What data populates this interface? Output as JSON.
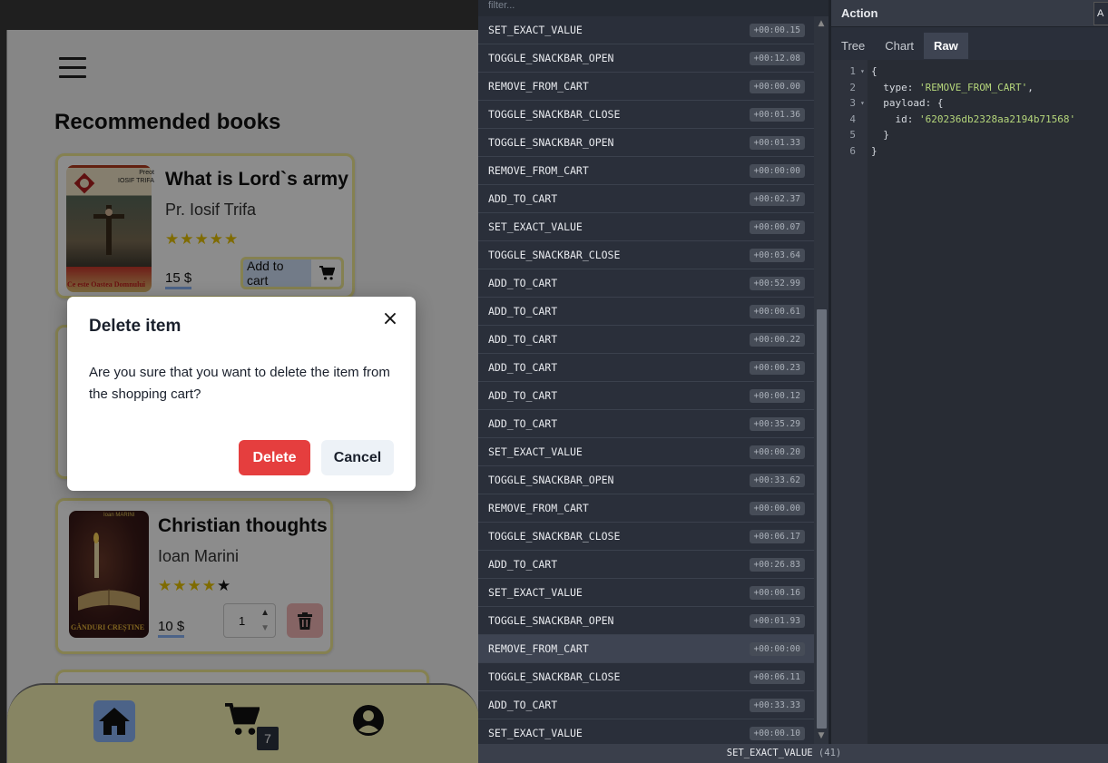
{
  "app": {
    "section_title": "Recommended books",
    "books": [
      {
        "title": "What is Lord`s army",
        "author": "Pr. Iosif Trifa",
        "rating": 5,
        "stars_full": "★★★★★",
        "stars_empty": "",
        "price": "15 $",
        "action_label": "Add to cart",
        "cover_top_text": "Preot\nIOSIF TRIFA",
        "cover_bottom_text": "Ce este Oastea Domnului"
      },
      {
        "title": "Christian thoughts",
        "author": "Ioan Marini",
        "rating": 4,
        "stars_full": "★★★★",
        "stars_empty": "★",
        "price": "10 $",
        "quantity": "1",
        "cover_top_text": "Ioan MARINI",
        "cover_bottom_text": "GÂNDURI CREȘTINE"
      }
    ],
    "cart_count": "7"
  },
  "dialog": {
    "title": "Delete item",
    "body": "Are you sure that you want to delete the item from the shopping cart?",
    "delete_label": "Delete",
    "cancel_label": "Cancel",
    "close_glyph": "×"
  },
  "devtools": {
    "filter_placeholder": "filter...",
    "actions": [
      {
        "name": "SET_EXACT_VALUE",
        "time": "+00:00.15"
      },
      {
        "name": "TOGGLE_SNACKBAR_OPEN",
        "time": "+00:12.08"
      },
      {
        "name": "REMOVE_FROM_CART",
        "time": "+00:00.00"
      },
      {
        "name": "TOGGLE_SNACKBAR_CLOSE",
        "time": "+00:01.36"
      },
      {
        "name": "TOGGLE_SNACKBAR_OPEN",
        "time": "+00:01.33"
      },
      {
        "name": "REMOVE_FROM_CART",
        "time": "+00:00:00"
      },
      {
        "name": "ADD_TO_CART",
        "time": "+00:02.37"
      },
      {
        "name": "SET_EXACT_VALUE",
        "time": "+00:00.07"
      },
      {
        "name": "TOGGLE_SNACKBAR_CLOSE",
        "time": "+00:03.64"
      },
      {
        "name": "ADD_TO_CART",
        "time": "+00:52.99"
      },
      {
        "name": "ADD_TO_CART",
        "time": "+00:00.61"
      },
      {
        "name": "ADD_TO_CART",
        "time": "+00:00.22"
      },
      {
        "name": "ADD_TO_CART",
        "time": "+00:00.23"
      },
      {
        "name": "ADD_TO_CART",
        "time": "+00:00.12"
      },
      {
        "name": "ADD_TO_CART",
        "time": "+00:35.29"
      },
      {
        "name": "SET_EXACT_VALUE",
        "time": "+00:00.20"
      },
      {
        "name": "TOGGLE_SNACKBAR_OPEN",
        "time": "+00:33.62"
      },
      {
        "name": "REMOVE_FROM_CART",
        "time": "+00:00.00"
      },
      {
        "name": "TOGGLE_SNACKBAR_CLOSE",
        "time": "+00:06.17"
      },
      {
        "name": "ADD_TO_CART",
        "time": "+00:26.83"
      },
      {
        "name": "SET_EXACT_VALUE",
        "time": "+00:00.16"
      },
      {
        "name": "TOGGLE_SNACKBAR_OPEN",
        "time": "+00:01.93"
      },
      {
        "name": "REMOVE_FROM_CART",
        "time": "+00:00:00",
        "selected": true
      },
      {
        "name": "TOGGLE_SNACKBAR_CLOSE",
        "time": "+00:06.11"
      },
      {
        "name": "ADD_TO_CART",
        "time": "+00:33.33"
      },
      {
        "name": "SET_EXACT_VALUE",
        "time": "+00:00.10"
      }
    ],
    "status_action": "SET_EXACT_VALUE",
    "status_count": "(41)",
    "inspector": {
      "title": "Action",
      "corner_label": "A",
      "tabs": [
        "Tree",
        "Chart",
        "Raw"
      ],
      "active_tab": "Raw",
      "code_lines": [
        {
          "n": "1",
          "fold": "▾",
          "text": "{"
        },
        {
          "n": "2",
          "fold": "",
          "key": "  type: ",
          "str": "'REMOVE_FROM_CART'",
          "tail": ","
        },
        {
          "n": "3",
          "fold": "▾",
          "text": "  payload: {"
        },
        {
          "n": "4",
          "fold": "",
          "key": "    id: ",
          "str": "'620236db2328aa2194b71568'",
          "tail": ""
        },
        {
          "n": "5",
          "fold": "",
          "text": "  }"
        },
        {
          "n": "6",
          "fold": "",
          "text": "}"
        }
      ]
    }
  },
  "colors": {
    "accent_yellow": "#f3ec94",
    "nav_bg": "#f6f2b4",
    "home_active": "#8ab4f8",
    "delete_red": "#e53e3e",
    "devtools_bg": "#2a2f3a",
    "code_string": "#b5d67b"
  }
}
